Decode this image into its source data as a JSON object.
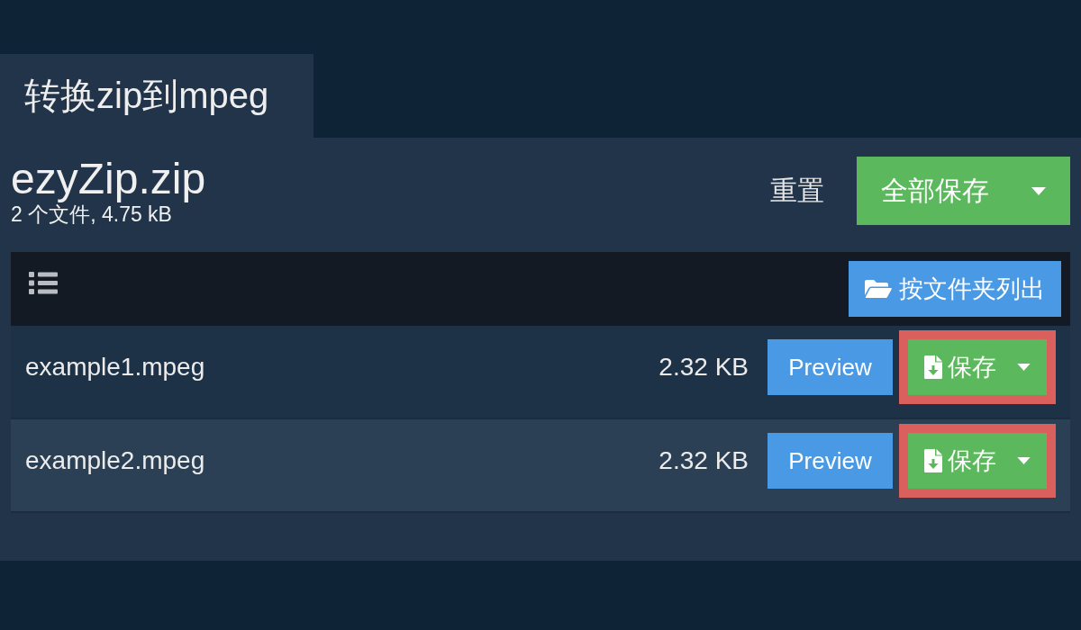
{
  "tab": {
    "title": "转换zip到mpeg"
  },
  "archive": {
    "name": "ezyZip.zip",
    "summary": "2 个文件, 4.75 kB"
  },
  "actions": {
    "reset": "重置",
    "save_all": "全部保存"
  },
  "toolbar": {
    "list_by_folder": "按文件夹列出"
  },
  "files": [
    {
      "name": "example1.mpeg",
      "size": "2.32 KB",
      "preview": "Preview",
      "save": "保存",
      "highlighted": true
    },
    {
      "name": "example2.mpeg",
      "size": "2.32 KB",
      "preview": "Preview",
      "save": "保存",
      "highlighted": true
    }
  ]
}
